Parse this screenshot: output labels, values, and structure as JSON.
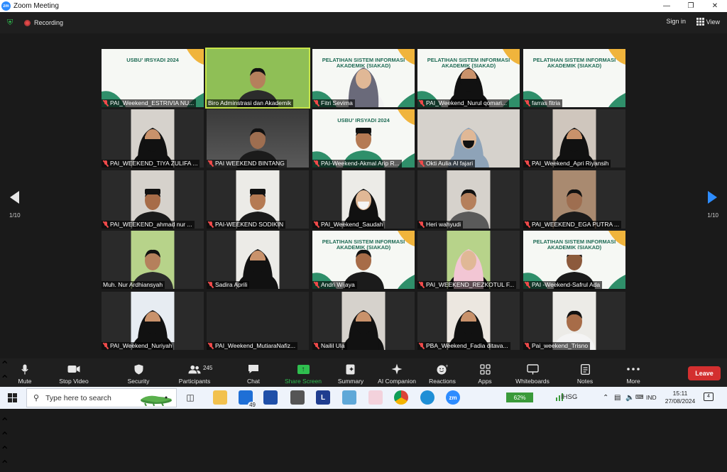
{
  "window": {
    "title": "Zoom Meeting",
    "app_icon": "zm",
    "controls": [
      "minimize-icon",
      "restore-icon",
      "close-icon"
    ]
  },
  "topbar": {
    "recording_label": "Recording",
    "signin_label": "Sign in",
    "view_label": "View"
  },
  "pagination": {
    "left": "1/10",
    "right": "1/10"
  },
  "participants": [
    {
      "name": "PAI_Weekend_ESTRIVIA NU...",
      "scene": "slide-usbu",
      "slide_text": "USBU' IRSYADI 2024",
      "muted": true
    },
    {
      "name": "Biro Adminstrasi dan Akademik",
      "scene": "green-cam",
      "muted": false,
      "active": true
    },
    {
      "name": "Fitri Sevima",
      "scene": "slide-siakad-hijab",
      "slide_text": "PELATIHAN SISTEM INFORMASI AKADEMIK (SIAKAD)",
      "muted": true
    },
    {
      "name": "PAI_Weekend_Nurul qomari...",
      "scene": "slide-siakad-niqab",
      "slide_text": "PELATIHAN SISTEM INFORMASI AKADEMIK (SIAKAD)",
      "muted": true
    },
    {
      "name": "farras fitria",
      "scene": "slide-siakad",
      "slide_text": "PELATIHAN SISTEM INFORMASI AKADEMIK (SIAKAD)",
      "muted": true
    },
    {
      "name": "PAI_WEEKEND_TIYA ZULIFA ...",
      "scene": "room-niqab",
      "muted": true
    },
    {
      "name": "PAI WEEKEND BINTANG",
      "scene": "dark-room",
      "muted": true
    },
    {
      "name": "PAI-Weekend-Akmal Arip R...",
      "scene": "slide-usbu-peci",
      "slide_text": "USBU' IRSYADI 2024",
      "muted": true
    },
    {
      "name": "Okti Aulia Al fajari",
      "scene": "room-hijab-mask",
      "muted": true
    },
    {
      "name": "PAI_Weekend_Apri Riyansih",
      "scene": "room-niqab-dark",
      "muted": true
    },
    {
      "name": "PAI_WEEKEND_ahmad nur ...",
      "scene": "room-peci",
      "muted": true
    },
    {
      "name": "PAI-WEEKEND SODIKIN",
      "scene": "room-peci-white",
      "muted": true
    },
    {
      "name": "PAI_Weekend_Saudah",
      "scene": "room-hijab-mask-white",
      "muted": true
    },
    {
      "name": "Heri wahyudi",
      "scene": "room-man",
      "muted": true
    },
    {
      "name": "PAI_WEEKEND_EGA PUTRA ...",
      "scene": "room-man-shelf",
      "muted": true
    },
    {
      "name": "Muh. Nur Ardhiansyah",
      "scene": "room-man-green",
      "muted": false
    },
    {
      "name": "Sadira Aprili",
      "scene": "room-niqab-white",
      "muted": true
    },
    {
      "name": "Andri Wijaya",
      "scene": "slide-siakad-man",
      "slide_text": "PELATIHAN SISTEM INFORMASI AKADEMIK (SIAKAD)",
      "muted": true
    },
    {
      "name": "PAI_WEEKEND_REZKOTUL F...",
      "scene": "room-hijab-green",
      "muted": true
    },
    {
      "name": "PAI -Weekend-Safrul Ada",
      "scene": "slide-siakad-man2",
      "slide_text": "PELATIHAN SISTEM INFORMASI AKADEMIK (SIAKAD)",
      "muted": true
    },
    {
      "name": "PAI_Weekend_Nuriyah",
      "scene": "room-niqab-blue",
      "muted": true
    },
    {
      "name": "PAI_Weekend_MutiaraNafiz...",
      "scene": "empty",
      "muted": true
    },
    {
      "name": "Nailil Ula",
      "scene": "room-niqab-plain",
      "muted": true
    },
    {
      "name": "PBA_Weekend_Fadia ditava...",
      "scene": "room-niqab-door",
      "muted": true
    },
    {
      "name": "Pai_weekend_Trisno",
      "scene": "room-man-white",
      "muted": true
    }
  ],
  "toolbar": {
    "mute": "Mute",
    "stop_video": "Stop Video",
    "security": "Security",
    "participants": "Participants",
    "participants_count": "245",
    "chat": "Chat",
    "share_screen": "Share Screen",
    "summary": "Summary",
    "ai_companion": "AI Companion",
    "reactions": "Reactions",
    "apps": "Apps",
    "whiteboards": "Whiteboards",
    "notes": "Notes",
    "more": "More",
    "leave": "Leave"
  },
  "taskbar": {
    "search_placeholder": "Type here to search",
    "mail_badge": "49",
    "battery": "62%",
    "ticker": "IHSG",
    "language": "IND",
    "time": "15:11",
    "date": "27/08/2024",
    "notifications": "4"
  },
  "colors": {
    "zoom_blue": "#2d8cff",
    "share_green": "#2fbf4f",
    "leave_red": "#d32f2f",
    "active_speaker": "#c8e64a"
  }
}
